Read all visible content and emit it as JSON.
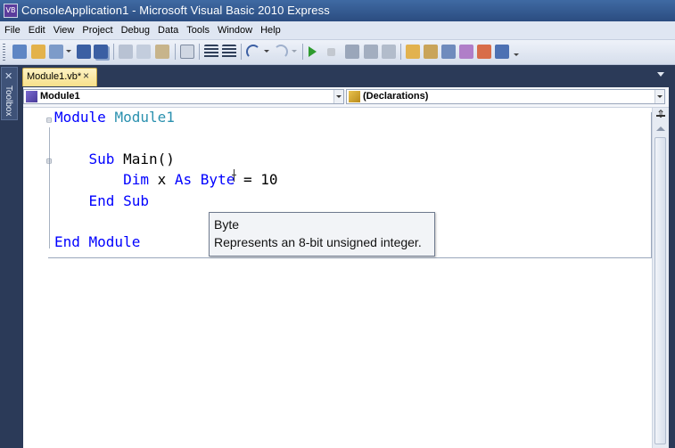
{
  "window": {
    "title": "ConsoleApplication1 - Microsoft Visual Basic 2010 Express",
    "icon_text": "VB"
  },
  "menu": {
    "items": [
      "File",
      "Edit",
      "View",
      "Project",
      "Debug",
      "Data",
      "Tools",
      "Window",
      "Help"
    ]
  },
  "toolbar": {
    "icons": [
      "new-project-icon",
      "open-file-icon",
      "add-item-icon",
      "save-icon",
      "save-all-icon",
      "cut-icon",
      "copy-icon",
      "paste-icon",
      "find-icon",
      "comment-icon",
      "uncomment-icon",
      "undo-icon",
      "redo-icon",
      "start-debugging-icon",
      "stop-debugging-icon",
      "step-into-icon",
      "step-over-icon",
      "step-out-icon",
      "solution-explorer-icon",
      "properties-icon",
      "object-browser-icon",
      "toolbox-icon",
      "extension-manager-icon",
      "output-window-icon"
    ]
  },
  "sidebar": {
    "toolbox_label": "Toolbox"
  },
  "tabs": {
    "active": {
      "label": "Module1.vb*",
      "close": "×"
    }
  },
  "navbar": {
    "left_combo": "Module1",
    "right_combo": "(Declarations)"
  },
  "code": {
    "line1": {
      "kw": "Module",
      "name": "Module1"
    },
    "line3": {
      "kw": "Sub",
      "rest": "Main()"
    },
    "line4": {
      "kw1": "Dim",
      "var": "x",
      "kw2": "As",
      "kw3": "Byte",
      "rest": "= 10"
    },
    "line5": {
      "kw": "End Sub"
    },
    "line7": {
      "kw": "End Module"
    },
    "collapse_glyph": "⊟"
  },
  "tooltip": {
    "title": "Byte",
    "description": "Represents an 8-bit unsigned integer."
  },
  "colors": {
    "keyword": "#0000ff",
    "type_name": "#2b91af",
    "tab_active": "#f7e08a",
    "chrome_dark": "#2b3a58"
  }
}
